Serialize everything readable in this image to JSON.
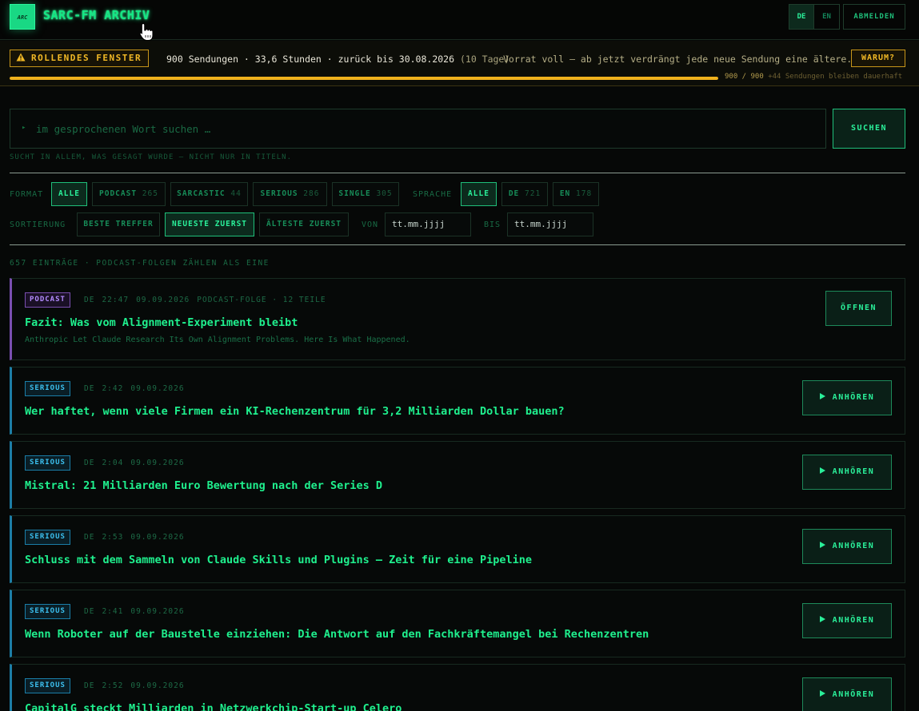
{
  "header": {
    "logo_text": "ARC",
    "title": "SARC-FM ARCHIV",
    "lang_de": "DE",
    "lang_en": "EN",
    "logout": "ABMELDEN"
  },
  "banner": {
    "badge": "ROLLENDES FENSTER",
    "summary": "900 Sendungen · 33,6 Stunden · zurück bis 30.08.2026",
    "days": "(10 Tage)",
    "note": "Vorrat voll — ab jetzt verdrängt jede neue Sendung eine ältere.",
    "why": "WARUM?",
    "progress_fraction": 1.0,
    "progress_label": "900 / 900",
    "progress_extra": "+44 Sendungen bleiben dauerhaft"
  },
  "search": {
    "placeholder": "im gesprochenen Wort suchen …",
    "button": "SUCHEN",
    "hint": "SUCHT IN ALLEM, WAS GESAGT WURDE — NICHT NUR IN TITELN."
  },
  "filters": {
    "format_label": "FORMAT",
    "format": [
      {
        "label": "ALLE",
        "count": ""
      },
      {
        "label": "PODCAST",
        "count": "265"
      },
      {
        "label": "SARCASTIC",
        "count": "44"
      },
      {
        "label": "SERIOUS",
        "count": "286"
      },
      {
        "label": "SINGLE",
        "count": "305"
      }
    ],
    "language_label": "SPRACHE",
    "language": [
      {
        "label": "ALLE",
        "count": ""
      },
      {
        "label": "DE",
        "count": "721"
      },
      {
        "label": "EN",
        "count": "178"
      }
    ],
    "sort_label": "SORTIERUNG",
    "sort": [
      "BESTE TREFFER",
      "NEUESTE ZUERST",
      "ÄLTESTE ZUERST"
    ],
    "from_label": "VON",
    "to_label": "BIS",
    "date_placeholder": "tt.mm.jjjj"
  },
  "result_count": "657 EINTRÄGE · PODCAST-FOLGEN ZÄHLEN ALS EINE",
  "entries": [
    {
      "tag": "PODCAST",
      "lang": "DE",
      "time": "22:47",
      "date": "09.09.2026",
      "extra": "PODCAST-FOLGE · 12 TEILE",
      "title": "Fazit: Was vom Alignment-Experiment bleibt",
      "subtitle": "Anthropic Let Claude Research Its Own Alignment Problems. Here Is What Happened.",
      "action": "ÖFFNEN"
    },
    {
      "tag": "SERIOUS",
      "lang": "DE",
      "time": "2:42",
      "date": "09.09.2026",
      "title": "Wer haftet, wenn viele Firmen ein KI-Rechenzentrum für 3,2 Milliarden Dollar bauen?",
      "action": "ANHÖREN"
    },
    {
      "tag": "SERIOUS",
      "lang": "DE",
      "time": "2:04",
      "date": "09.09.2026",
      "title": "Mistral: 21 Milliarden Euro Bewertung nach der Series D",
      "action": "ANHÖREN"
    },
    {
      "tag": "SERIOUS",
      "lang": "DE",
      "time": "2:53",
      "date": "09.09.2026",
      "title": "Schluss mit dem Sammeln von Claude Skills und Plugins – Zeit für eine Pipeline",
      "action": "ANHÖREN"
    },
    {
      "tag": "SERIOUS",
      "lang": "DE",
      "time": "2:41",
      "date": "09.09.2026",
      "title": "Wenn Roboter auf der Baustelle einziehen: Die Antwort auf den Fachkräftemangel bei Rechenzentren",
      "action": "ANHÖREN"
    },
    {
      "tag": "SERIOUS",
      "lang": "DE",
      "time": "2:52",
      "date": "09.09.2026",
      "title": "CapitalG steckt Milliarden in Netzwerkchip-Start-up Celero",
      "action": "ANHÖREN"
    }
  ]
}
